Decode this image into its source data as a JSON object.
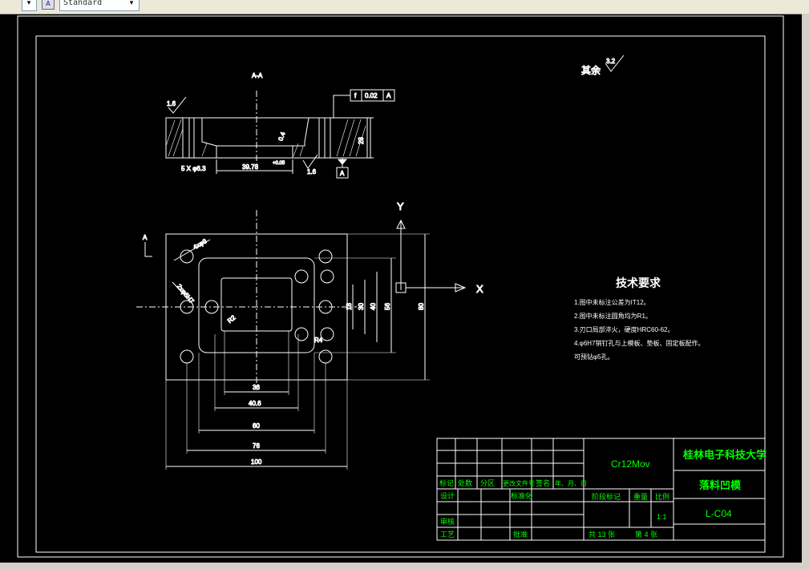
{
  "toolbar": {
    "style_value": "Standard",
    "icons": [
      "dropdown-arrow-icon",
      "text-style-icon",
      "dropdown-arrow-icon"
    ]
  },
  "colors": {
    "background": "#000000",
    "lines": "#ffffff",
    "title_block_text": "#00ff00"
  },
  "drawing": {
    "section_label": "A-A",
    "view_marker": "A",
    "roughness_other_prefix": "其余",
    "roughness_other_value": "3.2",
    "roughness_left": "1.6",
    "roughness_bottom": "1.6",
    "gdt_symbol": "f",
    "gdt_tolerance": "0.02",
    "gdt_datum": "A",
    "datum_label": "A",
    "section_dims": {
      "holes": "5 X φ6.3",
      "width": "39.78",
      "tolerance": "+0.05",
      "depth": "0.4",
      "height": "28"
    },
    "axis_x": "X",
    "axis_y": "Y",
    "plan_dims": {
      "d36": "36",
      "d40_6": "40.6",
      "d60": "60",
      "d76": "76",
      "d100": "100",
      "v18": "18",
      "v30": "30",
      "v40": "40",
      "v56": "56",
      "v80": "80",
      "hole_small": "4xφ8",
      "hole_large": "2xφ6H7",
      "r2": "R2",
      "r4": "R4"
    },
    "tech_req": {
      "title": "技术要求",
      "items": [
        "1.图中未标注公差为IT12。",
        "2.图中未标注圆角均为R1。",
        "3.刃口局部淬火，硬度HRC60-62。",
        "4.φ6H7销钉孔与上模板、垫板、固定板配作。",
        "可预钻φ5孔。"
      ]
    }
  },
  "title_block": {
    "material": "Cr12Mov",
    "school": "桂林电子科技大学",
    "part_name": "落料凹模",
    "drawing_no": "L-C04",
    "scale_label": "比例",
    "scale": "1:1",
    "weight_label": "重量",
    "stage_label": "阶段标记",
    "revision_headers": [
      "标记",
      "处数",
      "分区",
      "更改文件号",
      "签名",
      "年、月、日"
    ],
    "roles": {
      "design": "设计",
      "standardize": "标准化",
      "review": "审核",
      "process": "工艺",
      "approve": "批准"
    },
    "sheet_total": "共 13 张",
    "sheet_num": "第 4 张"
  }
}
